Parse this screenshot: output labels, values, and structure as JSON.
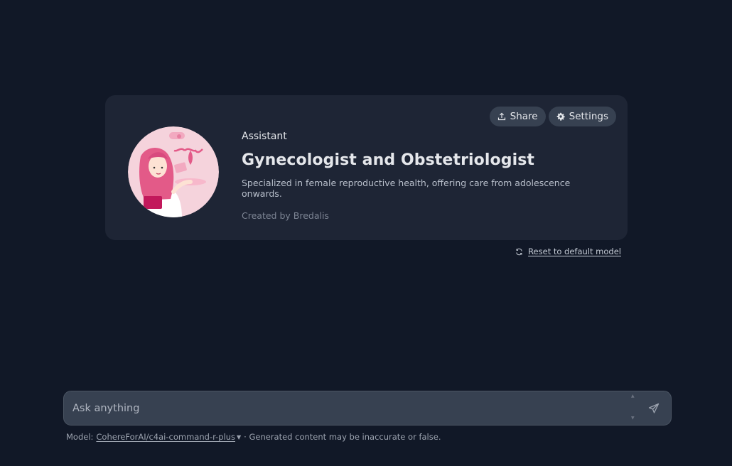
{
  "assistant": {
    "eyebrow": "Assistant",
    "name": "Gynecologist and Obstetriologist",
    "description": "Specialized in female reproductive health, offering care from adolescence onwards.",
    "created_by": "Created by Bredalis"
  },
  "actions": {
    "share_label": "Share",
    "settings_label": "Settings"
  },
  "reset_label": "Reset to default model",
  "chat": {
    "placeholder": "Ask anything"
  },
  "footer": {
    "model_prefix": "Model:",
    "model_name": "CohereForAI/c4ai-command-r-plus",
    "disclaimer": "· Generated content may be inaccurate or false."
  },
  "colors": {
    "background": "#111827",
    "card": "#1e2535",
    "pill": "#374151",
    "avatar_accent": "#ec4899"
  },
  "icons": [
    "share-icon",
    "gear-icon",
    "refresh-icon",
    "send-icon",
    "chevron-down-icon"
  ]
}
